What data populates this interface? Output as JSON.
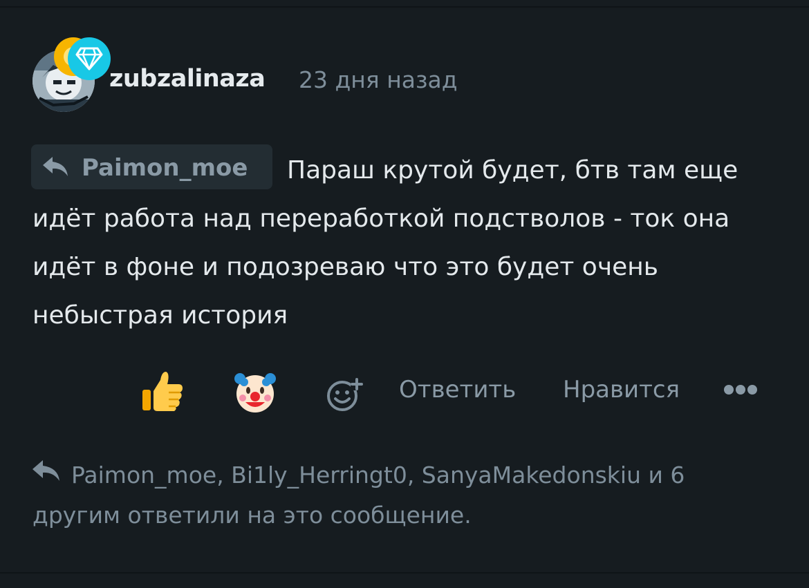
{
  "comment": {
    "username": "zubzalinaza",
    "timestamp": "23 дня назад",
    "reply_to": "Paimon_moe",
    "message": "Параш крутой будет, бтв там еще идёт работа над переработкой подстволов - ток она идёт в фоне и подозреваю что это будет очень небыстрая история"
  },
  "reactions": [
    {
      "icon": "thumbs-up-emoji"
    },
    {
      "icon": "clown-face-emoji"
    }
  ],
  "actions": {
    "add_reaction_icon": "add-reaction-icon",
    "reply_label": "Ответить",
    "like_label": "Нравится",
    "more_icon": "more-dots-icon"
  },
  "replies_summary": "Paimon_moe, Bi1ly_Herringt0, SanyaMakedonskiu и 6 другим ответили на это сообщение.",
  "colors": {
    "background": "#161c20",
    "primary_text": "#e4e9ec",
    "secondary_text": "#7e8e9a",
    "chip_background": "#232d33",
    "badge_diamond": "#18c8e6",
    "badge_gold": "#f7b500"
  }
}
